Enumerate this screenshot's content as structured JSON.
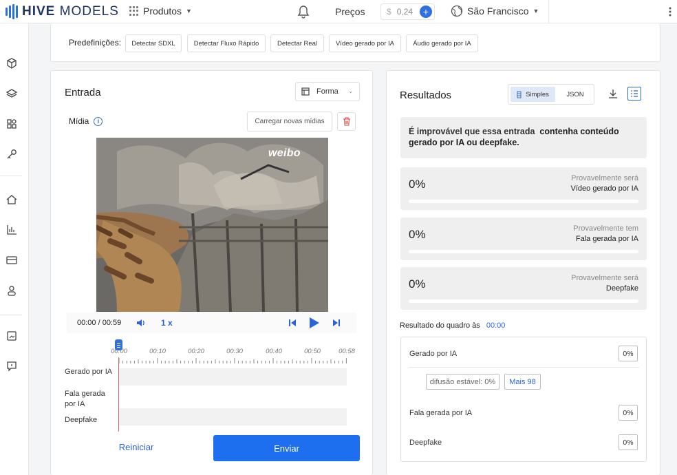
{
  "header": {
    "brand": {
      "bold": "HIVE",
      "rest": " MODELS"
    },
    "products_label": "Produtos",
    "pricing_label": "Preços",
    "balance": {
      "currency": "$",
      "amount": "0,24"
    },
    "location": "São Francisco"
  },
  "presets": {
    "label": "Predefinições:",
    "items": [
      "Detectar SDXL",
      "Detectar Fluxo Rápido",
      "Detectar Real",
      "Vídeo gerado por IA",
      "Áudio gerado por IA"
    ]
  },
  "input": {
    "title": "Entrada",
    "mode": "Forma",
    "media_label": "Mídia",
    "upload_label": "Carregar novas mídias",
    "watermark": "weibo",
    "time": "00:00 / 00:59",
    "speed": "1 x",
    "timeline_ticks": [
      "00:00",
      "00:10",
      "00:20",
      "00:30",
      "00:40",
      "00:50",
      "00:58"
    ],
    "tracks": [
      "Gerado por IA",
      "Fala gerada por IA",
      "Deepfake"
    ],
    "reset_label": "Reiniciar",
    "submit_label": "Enviar"
  },
  "results": {
    "title": "Resultados",
    "views": [
      "Simples",
      "JSON"
    ],
    "summary_pre": "É improvável que essa entrada",
    "summary_strong": "contenha conteúdo gerado por IA ou deepfake.",
    "metrics": [
      {
        "value": "0%",
        "caption": "Provavelmente será",
        "label": "Vídeo gerado por IA",
        "fraction": 0
      },
      {
        "value": "0%",
        "caption": "Provavelmente tem",
        "label": "Fala gerada por IA",
        "fraction": 0
      },
      {
        "value": "0%",
        "caption": "Provavelmente será",
        "label": "Deepfake",
        "fraction": 0
      }
    ],
    "frame_label": "Resultado do quadro às",
    "frame_time": "00:00",
    "frame": {
      "rows": [
        {
          "label": "Gerado por IA",
          "value": "0%"
        },
        {
          "label": "Fala gerada por IA",
          "value": "0%"
        },
        {
          "label": "Deepfake",
          "value": "0%"
        }
      ],
      "tags": [
        "difusão estável: 0%",
        "Mais 98"
      ]
    }
  },
  "colors": {
    "accent": "#1e6ff0",
    "link": "#2b63d8"
  }
}
